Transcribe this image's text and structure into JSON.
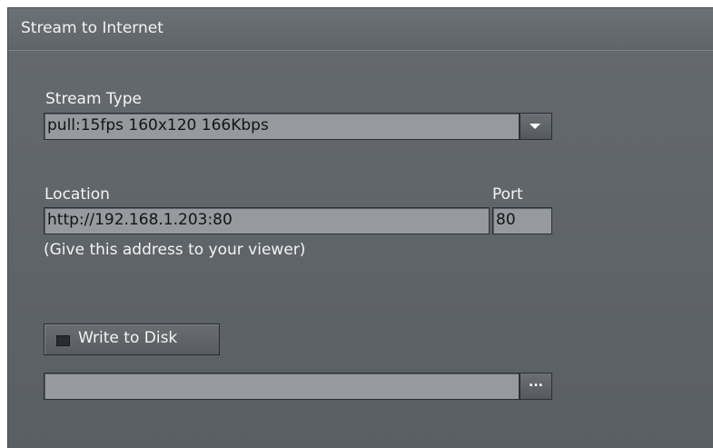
{
  "panel": {
    "title": "Stream to Internet"
  },
  "stream_type": {
    "label": "Stream Type",
    "selected": "pull:15fps 160x120 166Kbps",
    "dropdown_icon": "chevron-down-icon"
  },
  "location": {
    "label": "Location",
    "value": "http://192.168.1.203:80",
    "hint": "(Give this address to your viewer)"
  },
  "port": {
    "label": "Port",
    "value": "80"
  },
  "write_to_disk": {
    "label": "Write to Disk",
    "checked": false
  },
  "file_path": {
    "value": "",
    "browse_label": "..."
  }
}
